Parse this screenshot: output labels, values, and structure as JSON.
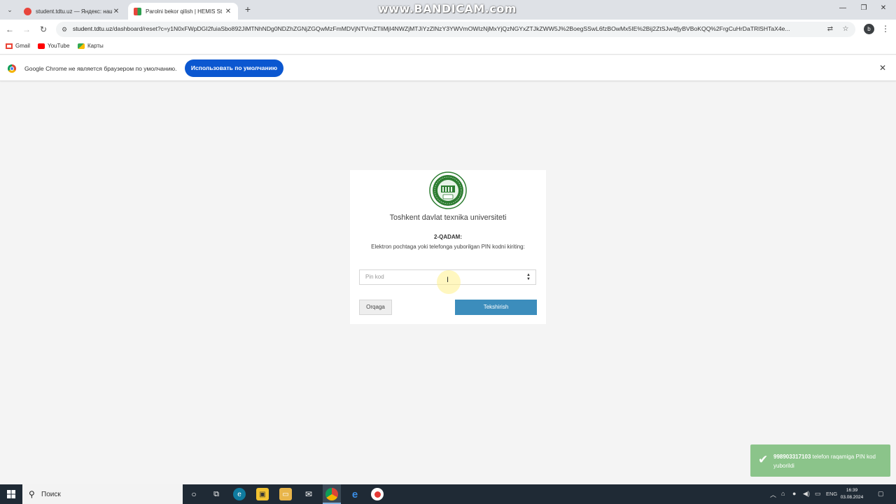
{
  "browser": {
    "tabs": [
      {
        "title": "student.tdtu.uz — Яндекс: наш",
        "favicon_color": "#e8453c",
        "active": false
      },
      {
        "title": "Parolni bekor qilish | HEMIS St",
        "favicon_color": "#2e9e4f",
        "active": true
      }
    ],
    "watermark": "www.BANDICAM.com",
    "address": {
      "url_host": "student.tdtu.uz",
      "url_rest": "/dashboard/reset?c=y1N0xFWpDGI2fuiaSbo892JiMTNhNDg0NDZhZGNjZGQwMzFmMDVjNTVmZTliMjI4NWZjMTJiYzZlNzY3YWVmOWIzNjMxYjQzNGYxZTJkZWW5J%2BoegSSwL6fzBOwMx5IE%2Bij2ZtSJw4fjyBVBoKQQ%2FrgCuHrDaTRlSHTaX4e..."
    },
    "bookmarks": [
      {
        "label": "Gmail",
        "color": "#ea4335"
      },
      {
        "label": "YouTube",
        "color": "#ff0000"
      },
      {
        "label": "Карты",
        "color": "#34a853"
      }
    ],
    "profile_initial": "b",
    "infobar": {
      "text": "Google Chrome не является браузером по умолчанию.",
      "button": "Использовать по умолчанию"
    }
  },
  "page": {
    "university": "Toshkent davlat texnika universiteti",
    "step_title": "2-QADAM:",
    "step_desc": "Elektron pochtaga yoki telefonga yuborilgan PIN kodni kiriting:",
    "pin_placeholder": "Pin kod",
    "back_label": "Orqaga",
    "submit_label": "Tekshirish",
    "accent_color": "#3c8dbc"
  },
  "toast": {
    "phone": "998903317103",
    "message": " telefon raqamiga PIN kod yuborildi",
    "color": "#8bc48a"
  },
  "taskbar": {
    "search_placeholder": "Поиск",
    "language": "ENG",
    "time": "16:39",
    "date": "03.08.2024"
  }
}
